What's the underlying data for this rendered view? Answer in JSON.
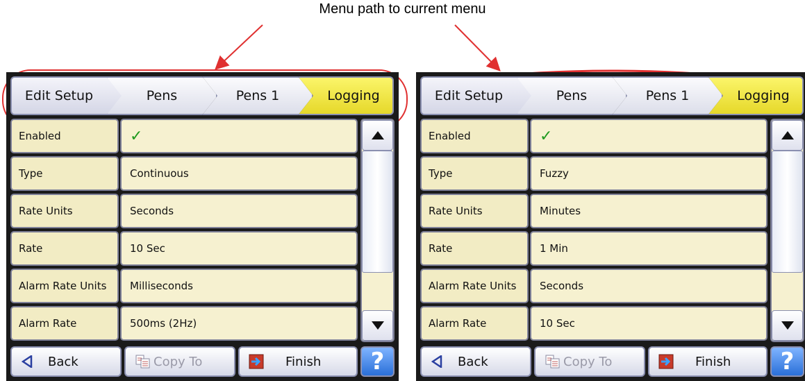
{
  "caption": "Menu path to current menu",
  "panels": [
    {
      "breadcrumb": [
        "Edit Setup",
        "Pens",
        "Pens 1",
        "Logging"
      ],
      "rows": [
        {
          "label": "Enabled",
          "value": "✓"
        },
        {
          "label": "Type",
          "value": "Continuous"
        },
        {
          "label": "Rate Units",
          "value": "Seconds"
        },
        {
          "label": "Rate",
          "value": "10 Sec"
        },
        {
          "label": "Alarm Rate Units",
          "value": "Milliseconds"
        },
        {
          "label": "Alarm Rate",
          "value": "500ms (2Hz)"
        }
      ],
      "buttons": {
        "back": "Back",
        "copy": "Copy To",
        "finish": "Finish",
        "help": "?"
      }
    },
    {
      "breadcrumb": [
        "Edit Setup",
        "Pens",
        "Pens 1",
        "Logging"
      ],
      "rows": [
        {
          "label": "Enabled",
          "value": "✓"
        },
        {
          "label": "Type",
          "value": "Fuzzy"
        },
        {
          "label": "Rate Units",
          "value": "Minutes"
        },
        {
          "label": "Rate",
          "value": "1 Min"
        },
        {
          "label": "Alarm Rate Units",
          "value": "Seconds"
        },
        {
          "label": "Alarm Rate",
          "value": "10 Sec"
        }
      ],
      "buttons": {
        "back": "Back",
        "copy": "Copy To",
        "finish": "Finish",
        "help": "?"
      }
    }
  ],
  "icons": {
    "scroll_up": "triangle-up-icon",
    "scroll_down": "triangle-down-icon",
    "back": "left-triangle-icon",
    "copy": "copy-icon",
    "finish": "exit-door-icon",
    "help": "help-icon"
  },
  "colors": {
    "active_crumb": "#e6d82a",
    "row_bg": "#f6f1d0",
    "callout": "#e03030",
    "tick": "#1f9a1f"
  }
}
